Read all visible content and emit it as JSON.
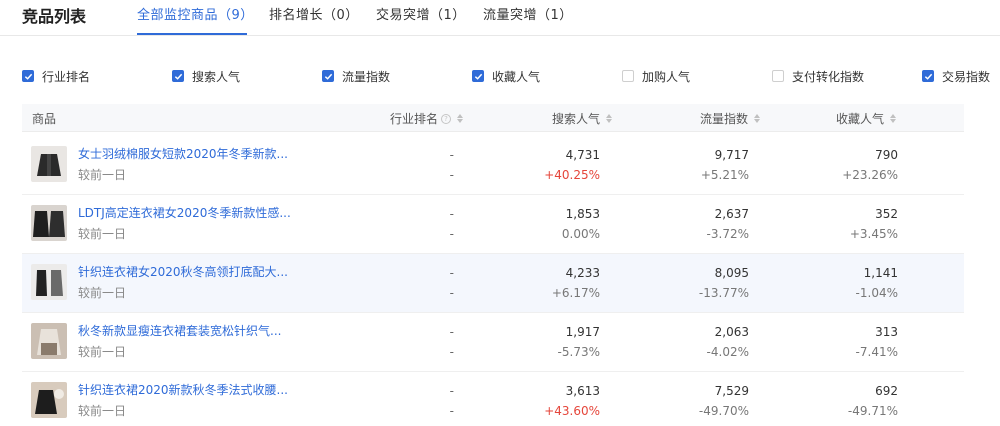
{
  "header": {
    "title": "竞品列表",
    "tabs": [
      {
        "label": "全部监控商品（9）",
        "active": true
      },
      {
        "label": "排名增长（0）",
        "active": false
      },
      {
        "label": "交易突增（1）",
        "active": false
      },
      {
        "label": "流量突增（1）",
        "active": false
      }
    ]
  },
  "metrics": [
    {
      "label": "行业排名",
      "checked": true
    },
    {
      "label": "搜索人气",
      "checked": true
    },
    {
      "label": "流量指数",
      "checked": true
    },
    {
      "label": "收藏人气",
      "checked": true
    },
    {
      "label": "加购人气",
      "checked": false
    },
    {
      "label": "支付转化指数",
      "checked": false
    },
    {
      "label": "交易指数",
      "checked": true
    }
  ],
  "table": {
    "columns": {
      "product": "商品",
      "rank": "行业排名",
      "search": "搜索人气",
      "traffic": "流量指数",
      "favorite": "收藏人气"
    },
    "rows": [
      {
        "name": "女士羽绒棉服女短款2020年冬季新款...",
        "sub": "较前一日",
        "rank": "-",
        "rank_change": "-",
        "search": "4,731",
        "search_change": "+40.25%",
        "traffic": "9,717",
        "traffic_change": "+5.21%",
        "favorite": "790",
        "favorite_change": "+23.26%"
      },
      {
        "name": "LDTJ高定连衣裙女2020冬季新款性感...",
        "sub": "较前一日",
        "rank": "-",
        "rank_change": "-",
        "search": "1,853",
        "search_change": "0.00%",
        "traffic": "2,637",
        "traffic_change": "-3.72%",
        "favorite": "352",
        "favorite_change": "+3.45%"
      },
      {
        "name": "针织连衣裙女2020秋冬高领打底配大...",
        "sub": "较前一日",
        "rank": "-",
        "rank_change": "-",
        "search": "4,233",
        "search_change": "+6.17%",
        "traffic": "8,095",
        "traffic_change": "-13.77%",
        "favorite": "1,141",
        "favorite_change": "-1.04%"
      },
      {
        "name": "秋冬新款显瘦连衣裙套装宽松针织气...",
        "sub": "较前一日",
        "rank": "-",
        "rank_change": "-",
        "search": "1,917",
        "search_change": "-5.73%",
        "traffic": "2,063",
        "traffic_change": "-4.02%",
        "favorite": "313",
        "favorite_change": "-7.41%"
      },
      {
        "name": "针织连衣裙2020新款秋冬季法式收腰...",
        "sub": "较前一日",
        "rank": "-",
        "rank_change": "-",
        "search": "3,613",
        "search_change": "+43.60%",
        "traffic": "7,529",
        "traffic_change": "-49.70%",
        "favorite": "692",
        "favorite_change": "-49.71%"
      }
    ]
  },
  "colors": {
    "accent": "#2f6bd8",
    "increase": "#e5463b",
    "muted": "#777777"
  }
}
